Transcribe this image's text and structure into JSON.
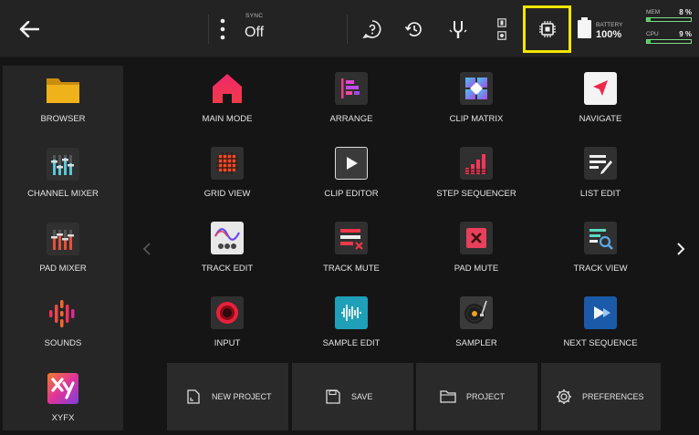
{
  "topbar": {
    "sync_label": "SYNC",
    "sync_value": "Off",
    "battery_label": "BATTERY",
    "battery_value": "100%",
    "mem_label": "MEM",
    "mem_value": "8 %",
    "mem_level": 0.08,
    "cpu_label": "CPU",
    "cpu_value": "9 %",
    "cpu_level": 0.09,
    "highlight_color": "#f2e600",
    "meter_color": "#3fd34d"
  },
  "sidebar": {
    "items": [
      {
        "label": "BROWSER",
        "icon": "folder-icon"
      },
      {
        "label": "CHANNEL MIXER",
        "icon": "channel-mixer-icon"
      },
      {
        "label": "PAD MIXER",
        "icon": "pad-mixer-icon"
      },
      {
        "label": "SOUNDS",
        "icon": "sounds-icon"
      },
      {
        "label": "XYFX",
        "icon": "xyfx-icon"
      }
    ]
  },
  "grid": {
    "items": [
      {
        "label": "MAIN MODE",
        "icon": "home-icon"
      },
      {
        "label": "ARRANGE",
        "icon": "arrange-icon"
      },
      {
        "label": "CLIP MATRIX",
        "icon": "clip-matrix-icon"
      },
      {
        "label": "NAVIGATE",
        "icon": "navigate-icon"
      },
      {
        "label": "GRID VIEW",
        "icon": "grid-view-icon"
      },
      {
        "label": "CLIP EDITOR",
        "icon": "clip-editor-icon"
      },
      {
        "label": "STEP SEQUENCER",
        "icon": "step-sequencer-icon"
      },
      {
        "label": "LIST EDIT",
        "icon": "list-edit-icon"
      },
      {
        "label": "TRACK EDIT",
        "icon": "track-edit-icon"
      },
      {
        "label": "TRACK MUTE",
        "icon": "track-mute-icon"
      },
      {
        "label": "PAD MUTE",
        "icon": "pad-mute-icon"
      },
      {
        "label": "TRACK VIEW",
        "icon": "track-view-icon"
      },
      {
        "label": "INPUT",
        "icon": "input-icon"
      },
      {
        "label": "SAMPLE EDIT",
        "icon": "sample-edit-icon"
      },
      {
        "label": "SAMPLER",
        "icon": "sampler-icon"
      },
      {
        "label": "NEXT SEQUENCE",
        "icon": "next-sequence-icon"
      }
    ]
  },
  "bottom": {
    "new_project": "NEW PROJECT",
    "save": "SAVE",
    "project": "PROJECT",
    "preferences": "PREFERENCES"
  }
}
